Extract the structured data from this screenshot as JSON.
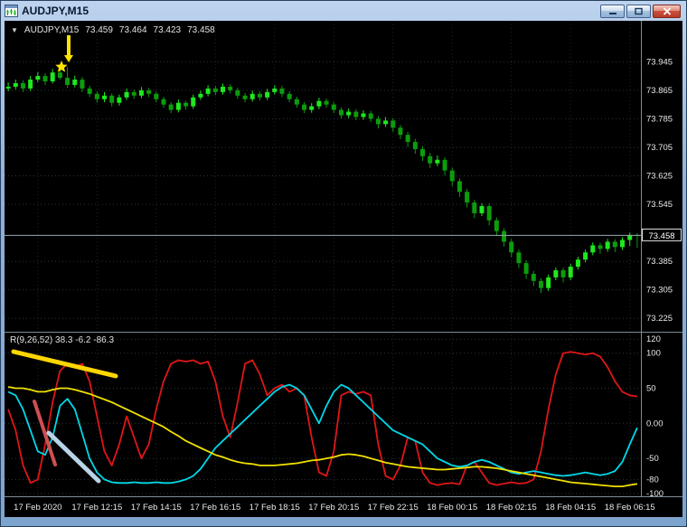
{
  "window": {
    "title": "AUDJPY,M15"
  },
  "chart": {
    "symbol_label": {
      "dropdown_glyph": "▼",
      "symbol": "AUDJPY,M15",
      "open": "73.459",
      "high": "73.464",
      "low": "73.423",
      "close": "73.458"
    }
  },
  "indicator": {
    "label": "R(9,26,52) 38.3 -6.2 -86.3"
  },
  "colors": {
    "background": "#000000",
    "bull": "#1fe81f",
    "bear": "#0c9c0c",
    "grid": "#2b353d",
    "vgrid": "#1d2428",
    "axis_text": "#e8e8e8",
    "bid_line": "#9aa8b5",
    "separator": "#7f8b96"
  },
  "chart_data": {
    "type": "candlestick",
    "title": "AUDJPY,M15",
    "price_axis": {
      "ticks": [
        "73.945",
        "73.865",
        "73.785",
        "73.705",
        "73.625",
        "73.545",
        "73.385",
        "73.305",
        "73.225"
      ],
      "top": 74.06,
      "bottom": 73.19,
      "bid": "73.458"
    },
    "osc_axis": {
      "ticks": [
        "120",
        "100",
        "50",
        "0.00",
        "-50",
        "-80",
        "-100"
      ],
      "top": 128,
      "bottom": -104
    },
    "time_labels": [
      "17 Feb 2020",
      "17 Feb 12:15",
      "17 Feb 14:15",
      "17 Feb 16:15",
      "17 Feb 18:15",
      "17 Feb 20:15",
      "17 Feb 22:15",
      "18 Feb 00:15",
      "18 Feb 02:15",
      "18 Feb 04:15",
      "18 Feb 06:15"
    ],
    "candles": [
      [
        73.87,
        73.887,
        73.862,
        73.875
      ],
      [
        73.875,
        73.895,
        73.868,
        73.885
      ],
      [
        73.885,
        73.893,
        73.86,
        73.87
      ],
      [
        73.87,
        73.905,
        73.863,
        73.895
      ],
      [
        73.895,
        73.916,
        73.888,
        73.905
      ],
      [
        73.905,
        73.913,
        73.88,
        73.89
      ],
      [
        73.89,
        73.925,
        73.884,
        73.915
      ],
      [
        73.915,
        73.938,
        73.895,
        73.9
      ],
      [
        73.9,
        73.93,
        73.872,
        73.88
      ],
      [
        73.88,
        73.906,
        73.873,
        73.895
      ],
      [
        73.895,
        73.902,
        73.86,
        73.87
      ],
      [
        73.87,
        73.878,
        73.846,
        73.855
      ],
      [
        73.855,
        73.862,
        73.83,
        73.84
      ],
      [
        73.84,
        73.86,
        73.832,
        73.85
      ],
      [
        73.85,
        73.856,
        73.82,
        73.83
      ],
      [
        73.83,
        73.853,
        73.822,
        73.845
      ],
      [
        73.845,
        73.87,
        73.838,
        73.86
      ],
      [
        73.86,
        73.867,
        73.841,
        73.85
      ],
      [
        73.85,
        73.874,
        73.843,
        73.865
      ],
      [
        73.865,
        73.872,
        73.846,
        73.855
      ],
      [
        73.855,
        73.861,
        73.831,
        73.84
      ],
      [
        73.84,
        73.847,
        73.816,
        73.825
      ],
      [
        73.825,
        73.832,
        73.801,
        73.81
      ],
      [
        73.81,
        73.839,
        73.803,
        73.83
      ],
      [
        73.83,
        73.836,
        73.811,
        73.82
      ],
      [
        73.82,
        73.853,
        73.813,
        73.845
      ],
      [
        73.845,
        73.864,
        73.838,
        73.855
      ],
      [
        73.855,
        73.879,
        73.848,
        73.87
      ],
      [
        73.87,
        73.877,
        73.851,
        73.86
      ],
      [
        73.86,
        73.884,
        73.853,
        73.875
      ],
      [
        73.875,
        73.882,
        73.856,
        73.865
      ],
      [
        73.865,
        73.872,
        73.841,
        73.85
      ],
      [
        73.85,
        73.857,
        73.831,
        73.84
      ],
      [
        73.84,
        73.864,
        73.833,
        73.855
      ],
      [
        73.855,
        73.862,
        73.836,
        73.845
      ],
      [
        73.845,
        73.869,
        73.838,
        73.86
      ],
      [
        73.86,
        73.879,
        73.853,
        73.87
      ],
      [
        73.87,
        73.877,
        73.846,
        73.855
      ],
      [
        73.855,
        73.862,
        73.831,
        73.84
      ],
      [
        73.84,
        73.847,
        73.816,
        73.825
      ],
      [
        73.825,
        73.832,
        73.801,
        73.81
      ],
      [
        73.81,
        73.829,
        73.802,
        73.82
      ],
      [
        73.82,
        73.844,
        73.812,
        73.835
      ],
      [
        73.835,
        73.842,
        73.816,
        73.825
      ],
      [
        73.825,
        73.832,
        73.801,
        73.81
      ],
      [
        73.81,
        73.817,
        73.786,
        73.795
      ],
      [
        73.795,
        73.814,
        73.787,
        73.805
      ],
      [
        73.805,
        73.812,
        73.781,
        73.79
      ],
      [
        73.79,
        73.809,
        73.782,
        73.8
      ],
      [
        73.8,
        73.807,
        73.776,
        73.785
      ],
      [
        73.785,
        73.793,
        73.758,
        73.77
      ],
      [
        73.77,
        73.79,
        73.762,
        73.78
      ],
      [
        73.78,
        73.787,
        73.748,
        73.76
      ],
      [
        73.76,
        73.768,
        73.728,
        73.74
      ],
      [
        73.74,
        73.748,
        73.706,
        73.72
      ],
      [
        73.72,
        73.729,
        73.687,
        73.7
      ],
      [
        73.7,
        73.708,
        73.667,
        73.68
      ],
      [
        73.68,
        73.689,
        73.647,
        73.66
      ],
      [
        73.66,
        73.682,
        73.652,
        73.67
      ],
      [
        73.67,
        73.677,
        73.626,
        73.64
      ],
      [
        73.64,
        73.648,
        73.596,
        73.61
      ],
      [
        73.61,
        73.618,
        73.566,
        73.58
      ],
      [
        73.58,
        73.588,
        73.536,
        73.55
      ],
      [
        73.55,
        73.558,
        73.506,
        73.52
      ],
      [
        73.52,
        73.548,
        73.512,
        73.54
      ],
      [
        73.54,
        73.547,
        73.486,
        73.5
      ],
      [
        73.5,
        73.508,
        73.456,
        73.47
      ],
      [
        73.47,
        73.478,
        73.426,
        73.44
      ],
      [
        73.44,
        73.448,
        73.396,
        73.41
      ],
      [
        73.41,
        73.418,
        73.366,
        73.38
      ],
      [
        73.38,
        73.388,
        73.336,
        73.35
      ],
      [
        73.35,
        73.358,
        73.316,
        73.33
      ],
      [
        73.33,
        73.338,
        73.296,
        73.31
      ],
      [
        73.31,
        73.348,
        73.302,
        73.34
      ],
      [
        73.34,
        73.368,
        73.332,
        73.36
      ],
      [
        73.36,
        73.367,
        73.326,
        73.34
      ],
      [
        73.34,
        73.378,
        73.332,
        73.37
      ],
      [
        73.37,
        73.398,
        73.362,
        73.39
      ],
      [
        73.39,
        73.418,
        73.382,
        73.41
      ],
      [
        73.41,
        73.438,
        73.402,
        73.43
      ],
      [
        73.43,
        73.437,
        73.406,
        73.42
      ],
      [
        73.42,
        73.448,
        73.412,
        73.44
      ],
      [
        73.44,
        73.447,
        73.411,
        73.425
      ],
      [
        73.425,
        73.453,
        73.417,
        73.445
      ],
      [
        73.445,
        73.466,
        73.428,
        73.459
      ],
      [
        73.459,
        73.464,
        73.423,
        73.458
      ]
    ],
    "oscillator": {
      "name": "R(9,26,52)",
      "current_values": [
        38.3,
        -6.2,
        -86.3
      ],
      "series": [
        {
          "name": "fast-red",
          "color": "#e01616",
          "values": [
            20,
            -10,
            -60,
            -85,
            -80,
            -30,
            30,
            75,
            85,
            80,
            85,
            60,
            10,
            -40,
            -60,
            -30,
            10,
            -20,
            -50,
            -30,
            20,
            60,
            85,
            90,
            88,
            90,
            85,
            88,
            60,
            10,
            -20,
            30,
            85,
            90,
            70,
            40,
            50,
            55,
            45,
            50,
            40,
            -20,
            -70,
            -75,
            -40,
            40,
            45,
            42,
            45,
            40,
            -30,
            -75,
            -80,
            -60,
            -20,
            -25,
            -70,
            -85,
            -88,
            -86,
            -85,
            -87,
            -60,
            -55,
            -70,
            -85,
            -88,
            -86,
            -84,
            -86,
            -85,
            -80,
            -40,
            20,
            70,
            100,
            102,
            100,
            98,
            100,
            95,
            80,
            60,
            45,
            40,
            38.3
          ]
        },
        {
          "name": "mid-cyan",
          "color": "#00d8e8",
          "values": [
            45,
            40,
            20,
            -10,
            -40,
            -45,
            -20,
            25,
            35,
            20,
            -15,
            -50,
            -70,
            -80,
            -84,
            -85,
            -85,
            -84,
            -85,
            -85,
            -84,
            -85,
            -85,
            -83,
            -80,
            -75,
            -65,
            -50,
            -35,
            -25,
            -15,
            -5,
            5,
            15,
            25,
            35,
            45,
            52,
            55,
            50,
            40,
            20,
            0,
            25,
            45,
            55,
            50,
            40,
            30,
            20,
            10,
            0,
            -10,
            -15,
            -20,
            -25,
            -30,
            -40,
            -50,
            -55,
            -60,
            -62,
            -60,
            -55,
            -52,
            -55,
            -60,
            -65,
            -70,
            -72,
            -70,
            -68,
            -70,
            -72,
            -74,
            -75,
            -74,
            -72,
            -70,
            -72,
            -74,
            -72,
            -68,
            -55,
            -30,
            -6.2
          ]
        },
        {
          "name": "slow-yellow",
          "color": "#f0e000",
          "values": [
            52,
            50,
            50,
            48,
            45,
            45,
            48,
            50,
            50,
            48,
            45,
            42,
            38,
            34,
            30,
            25,
            20,
            15,
            10,
            5,
            0,
            -5,
            -12,
            -18,
            -25,
            -30,
            -35,
            -40,
            -45,
            -48,
            -52,
            -55,
            -57,
            -58,
            -60,
            -60,
            -60,
            -59,
            -58,
            -57,
            -55,
            -53,
            -52,
            -50,
            -48,
            -45,
            -44,
            -45,
            -47,
            -50,
            -53,
            -56,
            -58,
            -60,
            -62,
            -63,
            -64,
            -65,
            -66,
            -66,
            -65,
            -64,
            -63,
            -62,
            -62,
            -63,
            -64,
            -66,
            -68,
            -70,
            -72,
            -74,
            -76,
            -78,
            -80,
            -82,
            -84,
            -85,
            -86,
            -87,
            -88,
            -89,
            -90,
            -90,
            -88,
            -86.3
          ]
        }
      ]
    },
    "annotations": {
      "arrow": {
        "color": "#ffe400",
        "x": 71,
        "y1": 16,
        "y2": 38,
        "head": 8
      },
      "star": {
        "color": "#ffe400",
        "x": 63,
        "y": 51,
        "r": 7
      },
      "trendlines": [
        {
          "name": "yellow-trendline",
          "color": "#ffd700",
          "width": 5,
          "x1": 10,
          "y1": 366,
          "x2": 123,
          "y2": 393
        },
        {
          "name": "red-trendline",
          "color": "#cf5050",
          "width": 4,
          "x1": 33,
          "y1": 421,
          "x2": 56,
          "y2": 491
        },
        {
          "name": "lightblue-trendline",
          "color": "#b8d4e6",
          "width": 5,
          "x1": 49,
          "y1": 456,
          "x2": 104,
          "y2": 509
        }
      ]
    }
  }
}
